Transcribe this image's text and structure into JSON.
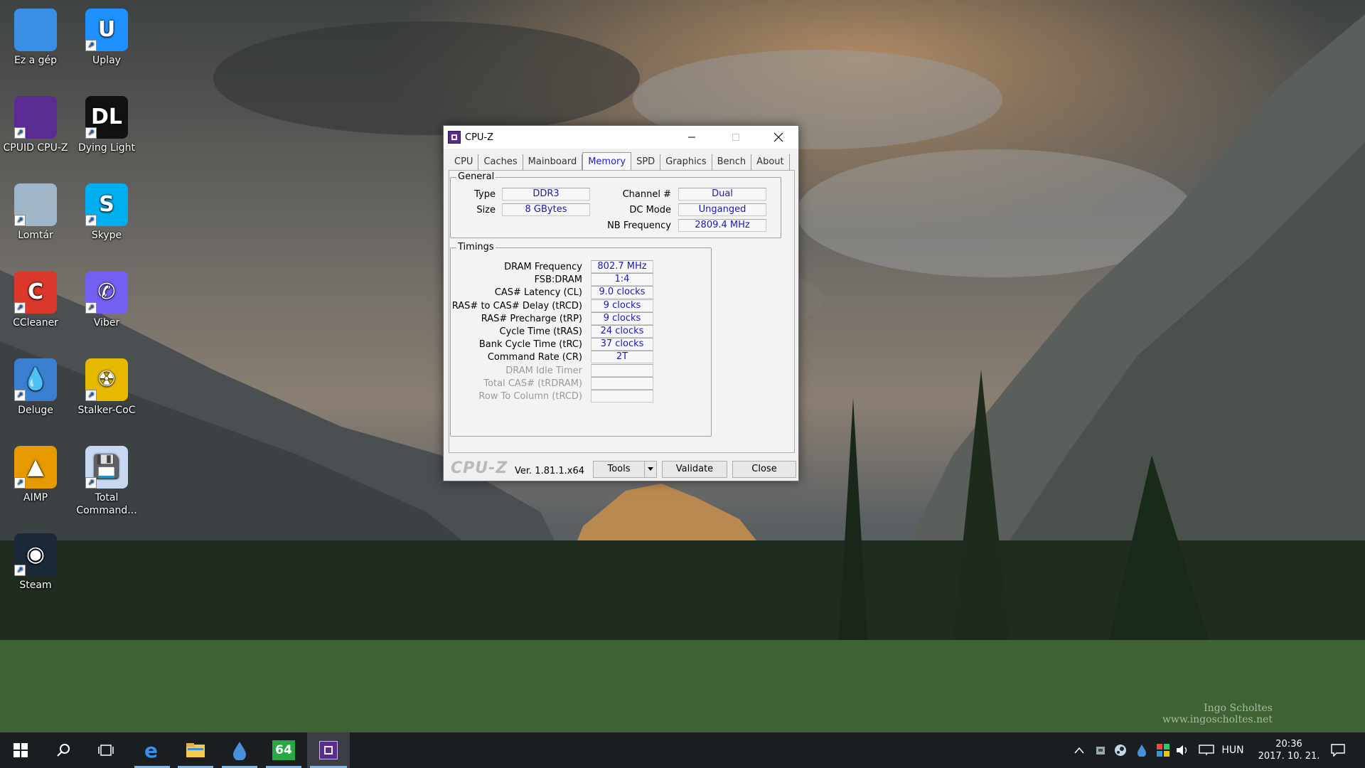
{
  "desktop": {
    "icons": [
      {
        "label": "Ez a gép",
        "icon": "computer-icon",
        "color": "#3a8ee6"
      },
      {
        "label": "Uplay",
        "icon": "uplay-icon",
        "color": "#1e90ff",
        "glyph": "U"
      },
      {
        "label": "CPUID CPU-Z",
        "icon": "cpuz-icon",
        "color": "#5a2c91"
      },
      {
        "label": "Dying Light",
        "icon": "dying-light-icon",
        "color": "#111111",
        "glyph": "DL"
      },
      {
        "label": "Lomtár",
        "icon": "recycle-bin-icon",
        "color": "#9fb6c8"
      },
      {
        "label": "Skype",
        "icon": "skype-icon",
        "color": "#00aff0",
        "glyph": "S"
      },
      {
        "label": "CCleaner",
        "icon": "ccleaner-icon",
        "color": "#d9382a",
        "glyph": "C"
      },
      {
        "label": "Viber",
        "icon": "viber-icon",
        "color": "#7360f2",
        "glyph": "✆"
      },
      {
        "label": "Deluge",
        "icon": "deluge-icon",
        "color": "#3b7fd0",
        "glyph": "💧"
      },
      {
        "label": "Stalker-CoC",
        "icon": "stalker-icon",
        "color": "#e6b800",
        "glyph": "☢"
      },
      {
        "label": "AIMP",
        "icon": "aimp-icon",
        "color": "#e69a00",
        "glyph": "▲"
      },
      {
        "label": "Total Command...",
        "icon": "total-commander-icon",
        "color": "#c8d8f0",
        "glyph": "💾"
      },
      {
        "label": "Steam",
        "icon": "steam-icon",
        "color": "#1b2838",
        "glyph": "◉"
      }
    ],
    "watermark": [
      "Ingo Scholtes",
      "www.ingoscholtes.net"
    ]
  },
  "window": {
    "title": "CPU-Z",
    "tabs": [
      "CPU",
      "Caches",
      "Mainboard",
      "Memory",
      "SPD",
      "Graphics",
      "Bench",
      "About"
    ],
    "active_tab": "Memory",
    "general": {
      "title": "General",
      "type_label": "Type",
      "type_value": "DDR3",
      "size_label": "Size",
      "size_value": "8 GBytes",
      "channel_label": "Channel #",
      "channel_value": "Dual",
      "dcmode_label": "DC Mode",
      "dcmode_value": "Unganged",
      "nbfreq_label": "NB Frequency",
      "nbfreq_value": "2809.4 MHz"
    },
    "timings": {
      "title": "Timings",
      "rows": [
        {
          "label": "DRAM Frequency",
          "value": "802.7 MHz",
          "disabled": false
        },
        {
          "label": "FSB:DRAM",
          "value": "1:4",
          "disabled": false
        },
        {
          "label": "CAS# Latency (CL)",
          "value": "9.0 clocks",
          "disabled": false
        },
        {
          "label": "RAS# to CAS# Delay (tRCD)",
          "value": "9 clocks",
          "disabled": false
        },
        {
          "label": "RAS# Precharge (tRP)",
          "value": "9 clocks",
          "disabled": false
        },
        {
          "label": "Cycle Time (tRAS)",
          "value": "24 clocks",
          "disabled": false
        },
        {
          "label": "Bank Cycle Time (tRC)",
          "value": "37 clocks",
          "disabled": false
        },
        {
          "label": "Command Rate (CR)",
          "value": "2T",
          "disabled": false
        },
        {
          "label": "DRAM Idle Timer",
          "value": "",
          "disabled": true
        },
        {
          "label": "Total CAS# (tRDRAM)",
          "value": "",
          "disabled": true
        },
        {
          "label": "Row To Column (tRCD)",
          "value": "",
          "disabled": true
        }
      ]
    },
    "footer": {
      "brand": "CPU-Z",
      "version": "Ver. 1.81.1.x64",
      "tools_label": "Tools",
      "validate_label": "Validate",
      "close_label": "Close"
    }
  },
  "taskbar": {
    "pinned": [
      {
        "name": "start-button",
        "icon": "windows-icon"
      },
      {
        "name": "search-button",
        "icon": "search-icon"
      },
      {
        "name": "task-view-button",
        "icon": "task-view-icon"
      },
      {
        "name": "taskbar-edge",
        "icon": "edge-icon"
      },
      {
        "name": "taskbar-explorer",
        "icon": "folder-icon"
      },
      {
        "name": "taskbar-deluge",
        "icon": "deluge-icon"
      },
      {
        "name": "taskbar-aida64",
        "icon": "aida64-icon",
        "text": "64"
      },
      {
        "name": "taskbar-cpuz",
        "icon": "cpuz-icon"
      }
    ],
    "tray": {
      "language": "HUN",
      "time": "20:36",
      "date": "2017. 10. 21."
    }
  }
}
